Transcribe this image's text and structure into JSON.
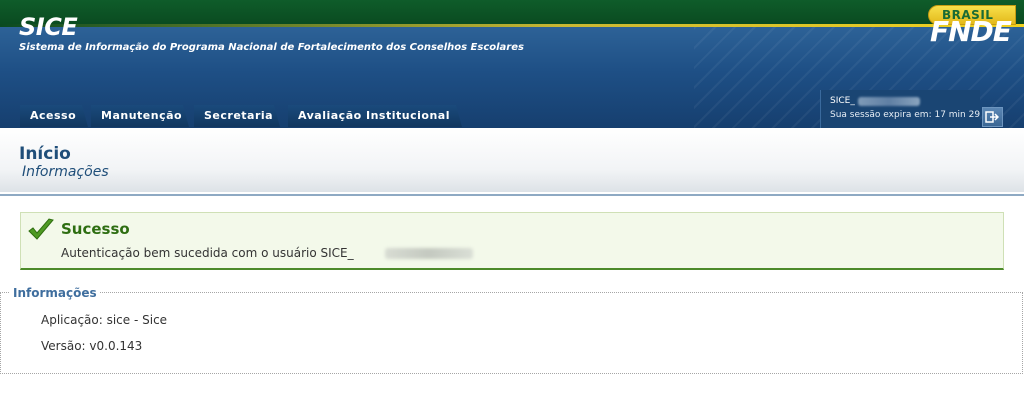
{
  "gov_bar": {
    "brand": "BRASIL"
  },
  "header": {
    "app_title": "SICE",
    "app_subtitle": "Sistema de Informação do Programa Nacional de Fortalecimento dos Conselhos Escolares",
    "org_logo": "FNDE"
  },
  "nav": {
    "tabs": [
      {
        "label": "Acesso"
      },
      {
        "label": "Manutenção"
      },
      {
        "label": "Secretaria"
      },
      {
        "label": "Avaliação Institucional"
      }
    ]
  },
  "session": {
    "user_prefix": "SICE_",
    "expire_text": "Sua sessão expira em: 17 min 29",
    "logout_icon": "logout-icon"
  },
  "page": {
    "title": "Início",
    "subtitle": "Informações"
  },
  "success": {
    "title": "Sucesso",
    "message": "Autenticação bem sucedida com o usuário SICE_",
    "icon": "checkmark-icon",
    "color": "#2e6e12"
  },
  "info": {
    "legend": "Informações",
    "application": "Aplicação: sice - Sice",
    "version": "Versão: v0.0.143"
  },
  "colors": {
    "header_blue": "#1e4f85",
    "gov_green": "#0f5c2a",
    "brasil_yellow": "#f1d21e",
    "title_blue": "#1f4e79"
  }
}
